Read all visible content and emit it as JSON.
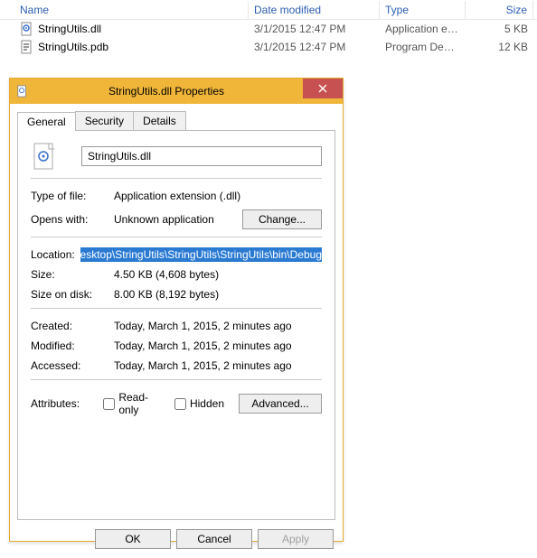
{
  "columns": {
    "name": "Name",
    "date": "Date modified",
    "type": "Type",
    "size": "Size"
  },
  "files": [
    {
      "name": "StringUtils.dll",
      "date": "3/1/2015 12:47 PM",
      "type": "Application extens...",
      "size": "5 KB"
    },
    {
      "name": "StringUtils.pdb",
      "date": "3/1/2015 12:47 PM",
      "type": "Program Debug D...",
      "size": "12 KB"
    }
  ],
  "dialog": {
    "title": "StringUtils.dll Properties",
    "tabs": [
      "General",
      "Security",
      "Details"
    ],
    "filename": "StringUtils.dll",
    "labels": {
      "type_of_file": "Type of file:",
      "opens_with": "Opens with:",
      "location": "Location:",
      "size": "Size:",
      "size_on_disk": "Size on disk:",
      "created": "Created:",
      "modified": "Modified:",
      "accessed": "Accessed:",
      "attributes": "Attributes:",
      "read_only": "Read-only",
      "hidden": "Hidden"
    },
    "values": {
      "type_of_file": "Application extension (.dll)",
      "opens_with": "Unknown application",
      "location": "esktop\\StringUtils\\StringUtils\\StringUtils\\bin\\Debug",
      "size": "4.50 KB (4,608 bytes)",
      "size_on_disk": "8.00 KB (8,192 bytes)",
      "created": "Today, March 1, 2015, 2 minutes ago",
      "modified": "Today, March 1, 2015, 2 minutes ago",
      "accessed": "Today, March 1, 2015, 2 minutes ago"
    },
    "buttons": {
      "change": "Change...",
      "advanced": "Advanced...",
      "ok": "OK",
      "cancel": "Cancel",
      "apply": "Apply"
    }
  }
}
